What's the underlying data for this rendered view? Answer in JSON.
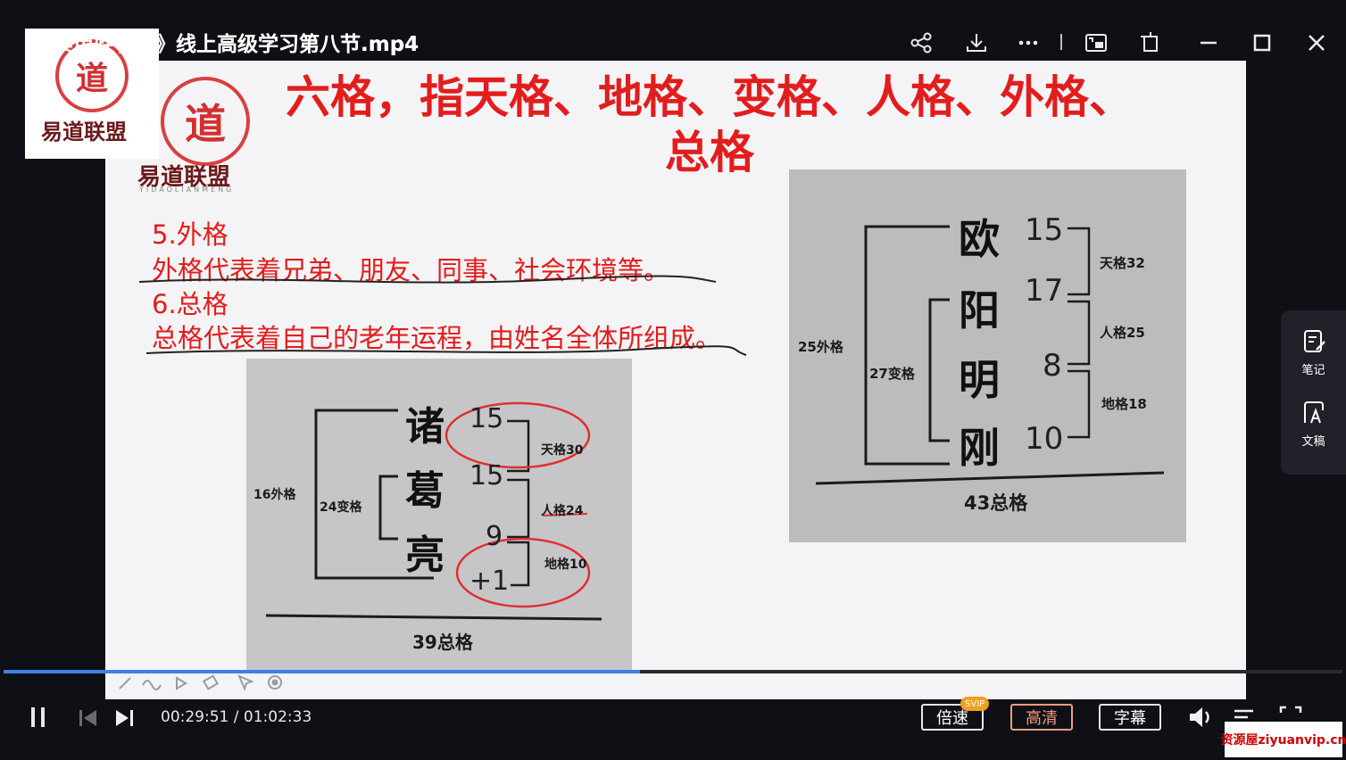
{
  "window": {
    "title": "《实用姓名学》线上高级学习第八节.mp4",
    "controls": [
      "share",
      "download",
      "more",
      "picture-in-picture",
      "pin",
      "minimize",
      "maximize",
      "close"
    ]
  },
  "logo": {
    "seal_char": "道",
    "brand": "易道联盟",
    "brand_sub": "YIDAOLIANMENG"
  },
  "slide": {
    "heading_line1": "六格，指天格、地格、变格、人格、外格、",
    "heading_line2": "总格",
    "point5_title": "5.外格",
    "point5_body": "外格代表着兄弟、朋友、同事、社会环境等。",
    "point6_title": "6.总格",
    "point6_body": "总格代表着自己的老年运程，由姓名全体所组成。",
    "left_example": {
      "chars": [
        "诸",
        "葛",
        "亮"
      ],
      "numbers": [
        "15",
        "15",
        "9",
        "+1"
      ],
      "right_labels": [
        "天格30",
        "人格24",
        "地格10"
      ],
      "outer_label": "16外格",
      "change_label": "24变格",
      "total": "39总格"
    },
    "right_example": {
      "chars": [
        "欧",
        "阳",
        "明",
        "刚"
      ],
      "numbers": [
        "15",
        "17",
        "8",
        "10"
      ],
      "right_labels": [
        "天格32",
        "人格25",
        "地格18"
      ],
      "outer_label": "25外格",
      "change_label": "27变格",
      "total": "43总格"
    }
  },
  "side_panel": {
    "items": [
      {
        "label": "笔记",
        "icon": "note-edit-icon"
      },
      {
        "label": "文稿",
        "icon": "document-ai-icon"
      }
    ]
  },
  "player": {
    "time_current": "00:29:51",
    "time_separator": " / ",
    "time_total": "01:02:33",
    "progress": 0.475,
    "speed_label": "倍速",
    "speed_badge": "SVIP",
    "quality_label": "高清",
    "subtitle_label": "字幕"
  },
  "watermark": "资源屋ziyuanvip.cn",
  "colors": {
    "heading": "#e21d1d",
    "progress": "#3e7fe8",
    "badge": "#f0a020",
    "quality": "#f39c80"
  }
}
